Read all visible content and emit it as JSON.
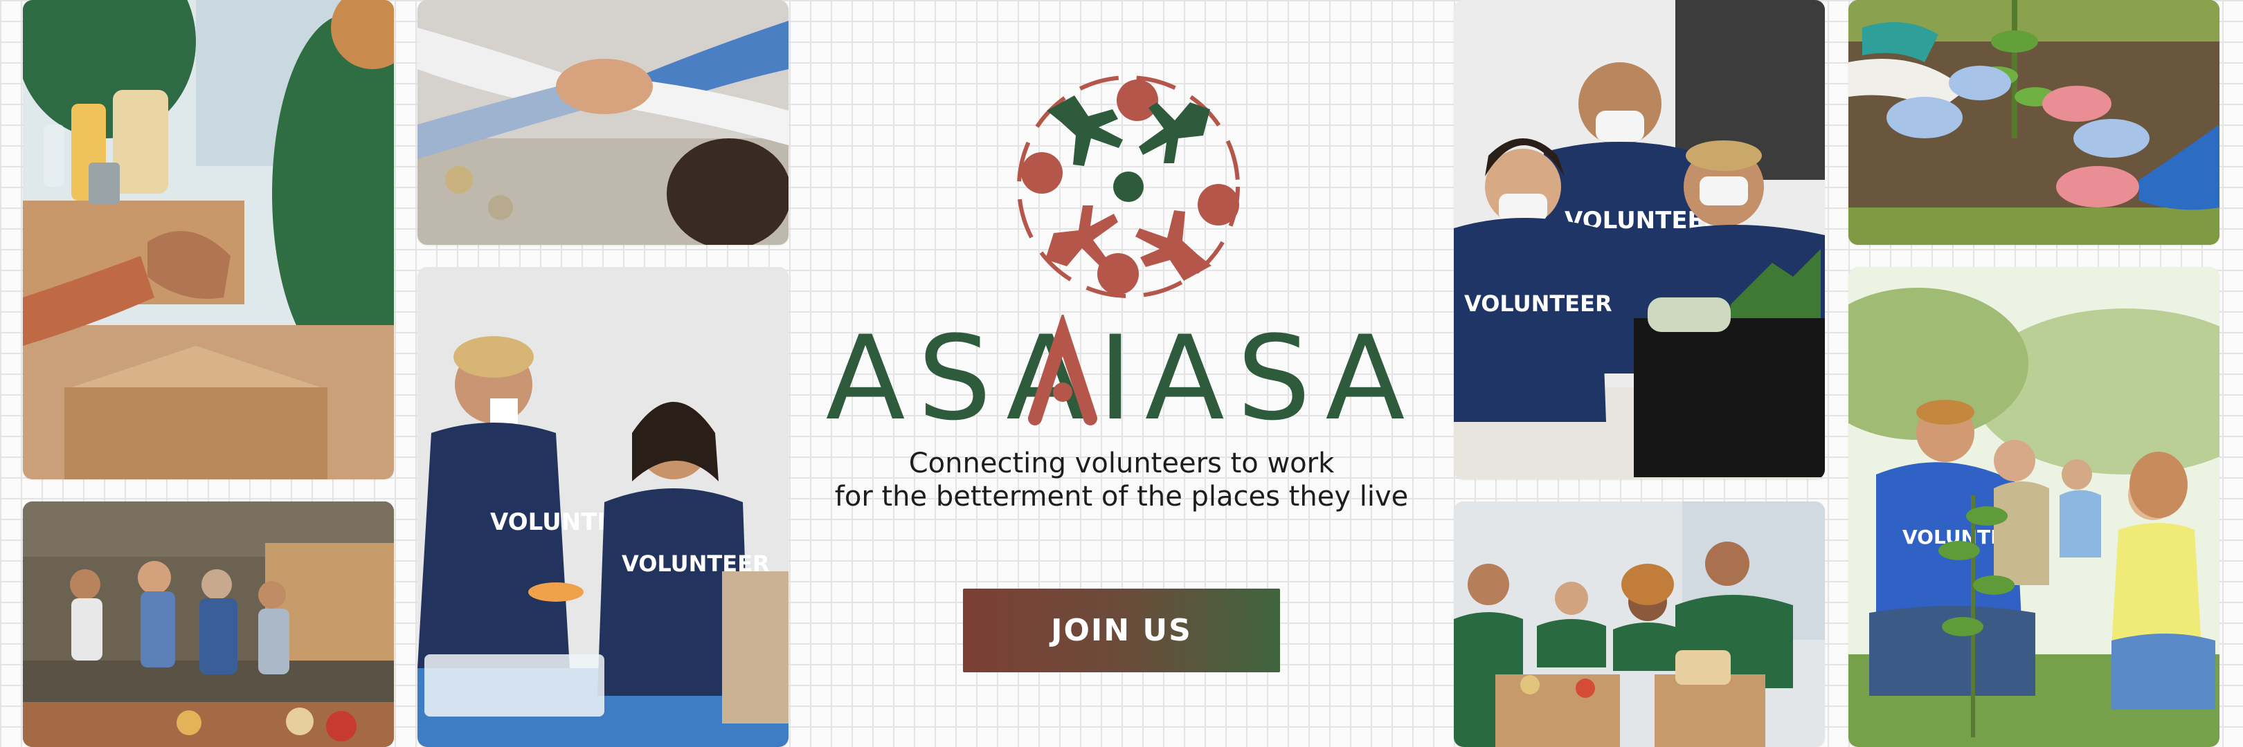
{
  "brand": {
    "name": "ASAIASA",
    "primary_color": "#2f5b3d",
    "accent_color": "#b5564b"
  },
  "tagline": {
    "line1": "Connecting volunteers to work",
    "line2": "for the betterment of the places they live"
  },
  "cta": {
    "label": "JOIN US"
  },
  "photos": {
    "food_box": {
      "icon": "food-donation-photo"
    },
    "hands_together": {
      "icon": "hands-together-photo"
    },
    "warehouse": {
      "icon": "warehouse-volunteers-photo"
    },
    "volunteers_sorting": {
      "shirt_text_1": "VOLUNTEER",
      "shirt_text_2": "VOLUNTEER"
    },
    "team_masks": {
      "shirt_text_1": "VOLUNTEER",
      "shirt_text_2": "VOLUNTEER"
    },
    "food_drive": {
      "icon": "food-drive-photo"
    },
    "planting_gloves": {
      "icon": "planting-gloves-photo"
    },
    "tree_planting": {
      "shirt_text": "VOLUNTEER"
    }
  }
}
